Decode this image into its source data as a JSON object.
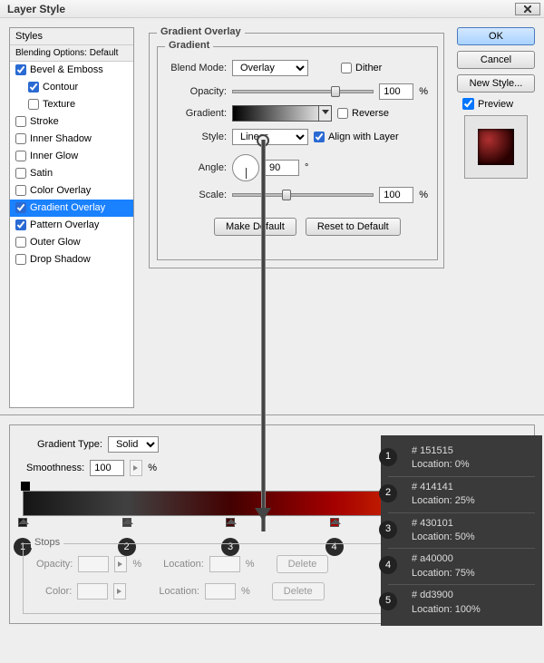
{
  "window": {
    "title": "Layer Style"
  },
  "styles_panel": {
    "header": "Styles",
    "blending": "Blending Options: Default",
    "items": [
      {
        "label": "Bevel & Emboss",
        "checked": true
      },
      {
        "label": "Contour",
        "checked": true,
        "indent": true
      },
      {
        "label": "Texture",
        "checked": false,
        "indent": true
      },
      {
        "label": "Stroke",
        "checked": false
      },
      {
        "label": "Inner Shadow",
        "checked": false
      },
      {
        "label": "Inner Glow",
        "checked": false
      },
      {
        "label": "Satin",
        "checked": false
      },
      {
        "label": "Color Overlay",
        "checked": false
      },
      {
        "label": "Gradient Overlay",
        "checked": true,
        "selected": true
      },
      {
        "label": "Pattern Overlay",
        "checked": true
      },
      {
        "label": "Outer Glow",
        "checked": false
      },
      {
        "label": "Drop Shadow",
        "checked": false
      }
    ]
  },
  "overlay": {
    "title": "Gradient Overlay",
    "subtitle": "Gradient",
    "blend_mode_label": "Blend Mode:",
    "blend_mode": "Overlay",
    "dither": "Dither",
    "opacity_label": "Opacity:",
    "opacity": "100",
    "pct": "%",
    "gradient_label": "Gradient:",
    "reverse": "Reverse",
    "style_label": "Style:",
    "style": "Linear",
    "align": "Align with Layer",
    "angle_label": "Angle:",
    "angle": "90",
    "deg": "°",
    "scale_label": "Scale:",
    "scale": "100",
    "make_default": "Make Default",
    "reset_default": "Reset to Default"
  },
  "buttons": {
    "ok": "OK",
    "cancel": "Cancel",
    "new_style": "New Style...",
    "preview": "Preview"
  },
  "editor": {
    "gradient_type_label": "Gradient Type:",
    "gradient_type": "Solid",
    "smoothness_label": "Smoothness:",
    "smoothness": "100",
    "pct": "%",
    "stops_title": "Stops",
    "opacity_label": "Opacity:",
    "location_label": "Location:",
    "color_label": "Color:",
    "delete": "Delete"
  },
  "stops": [
    {
      "n": "1",
      "hex": "# 151515",
      "loc": "Location: 0%",
      "pos": 0
    },
    {
      "n": "2",
      "hex": "# 414141",
      "loc": "Location: 25%",
      "pos": 25
    },
    {
      "n": "3",
      "hex": "# 430101",
      "loc": "Location: 50%",
      "pos": 50
    },
    {
      "n": "4",
      "hex": "# a40000",
      "loc": "Location: 75%",
      "pos": 75
    },
    {
      "n": "5",
      "hex": "# dd3900",
      "loc": "Location: 100%",
      "pos": 100
    }
  ],
  "stop_colors": [
    "#151515",
    "#414141",
    "#430101",
    "#a40000",
    "#dd3900"
  ]
}
